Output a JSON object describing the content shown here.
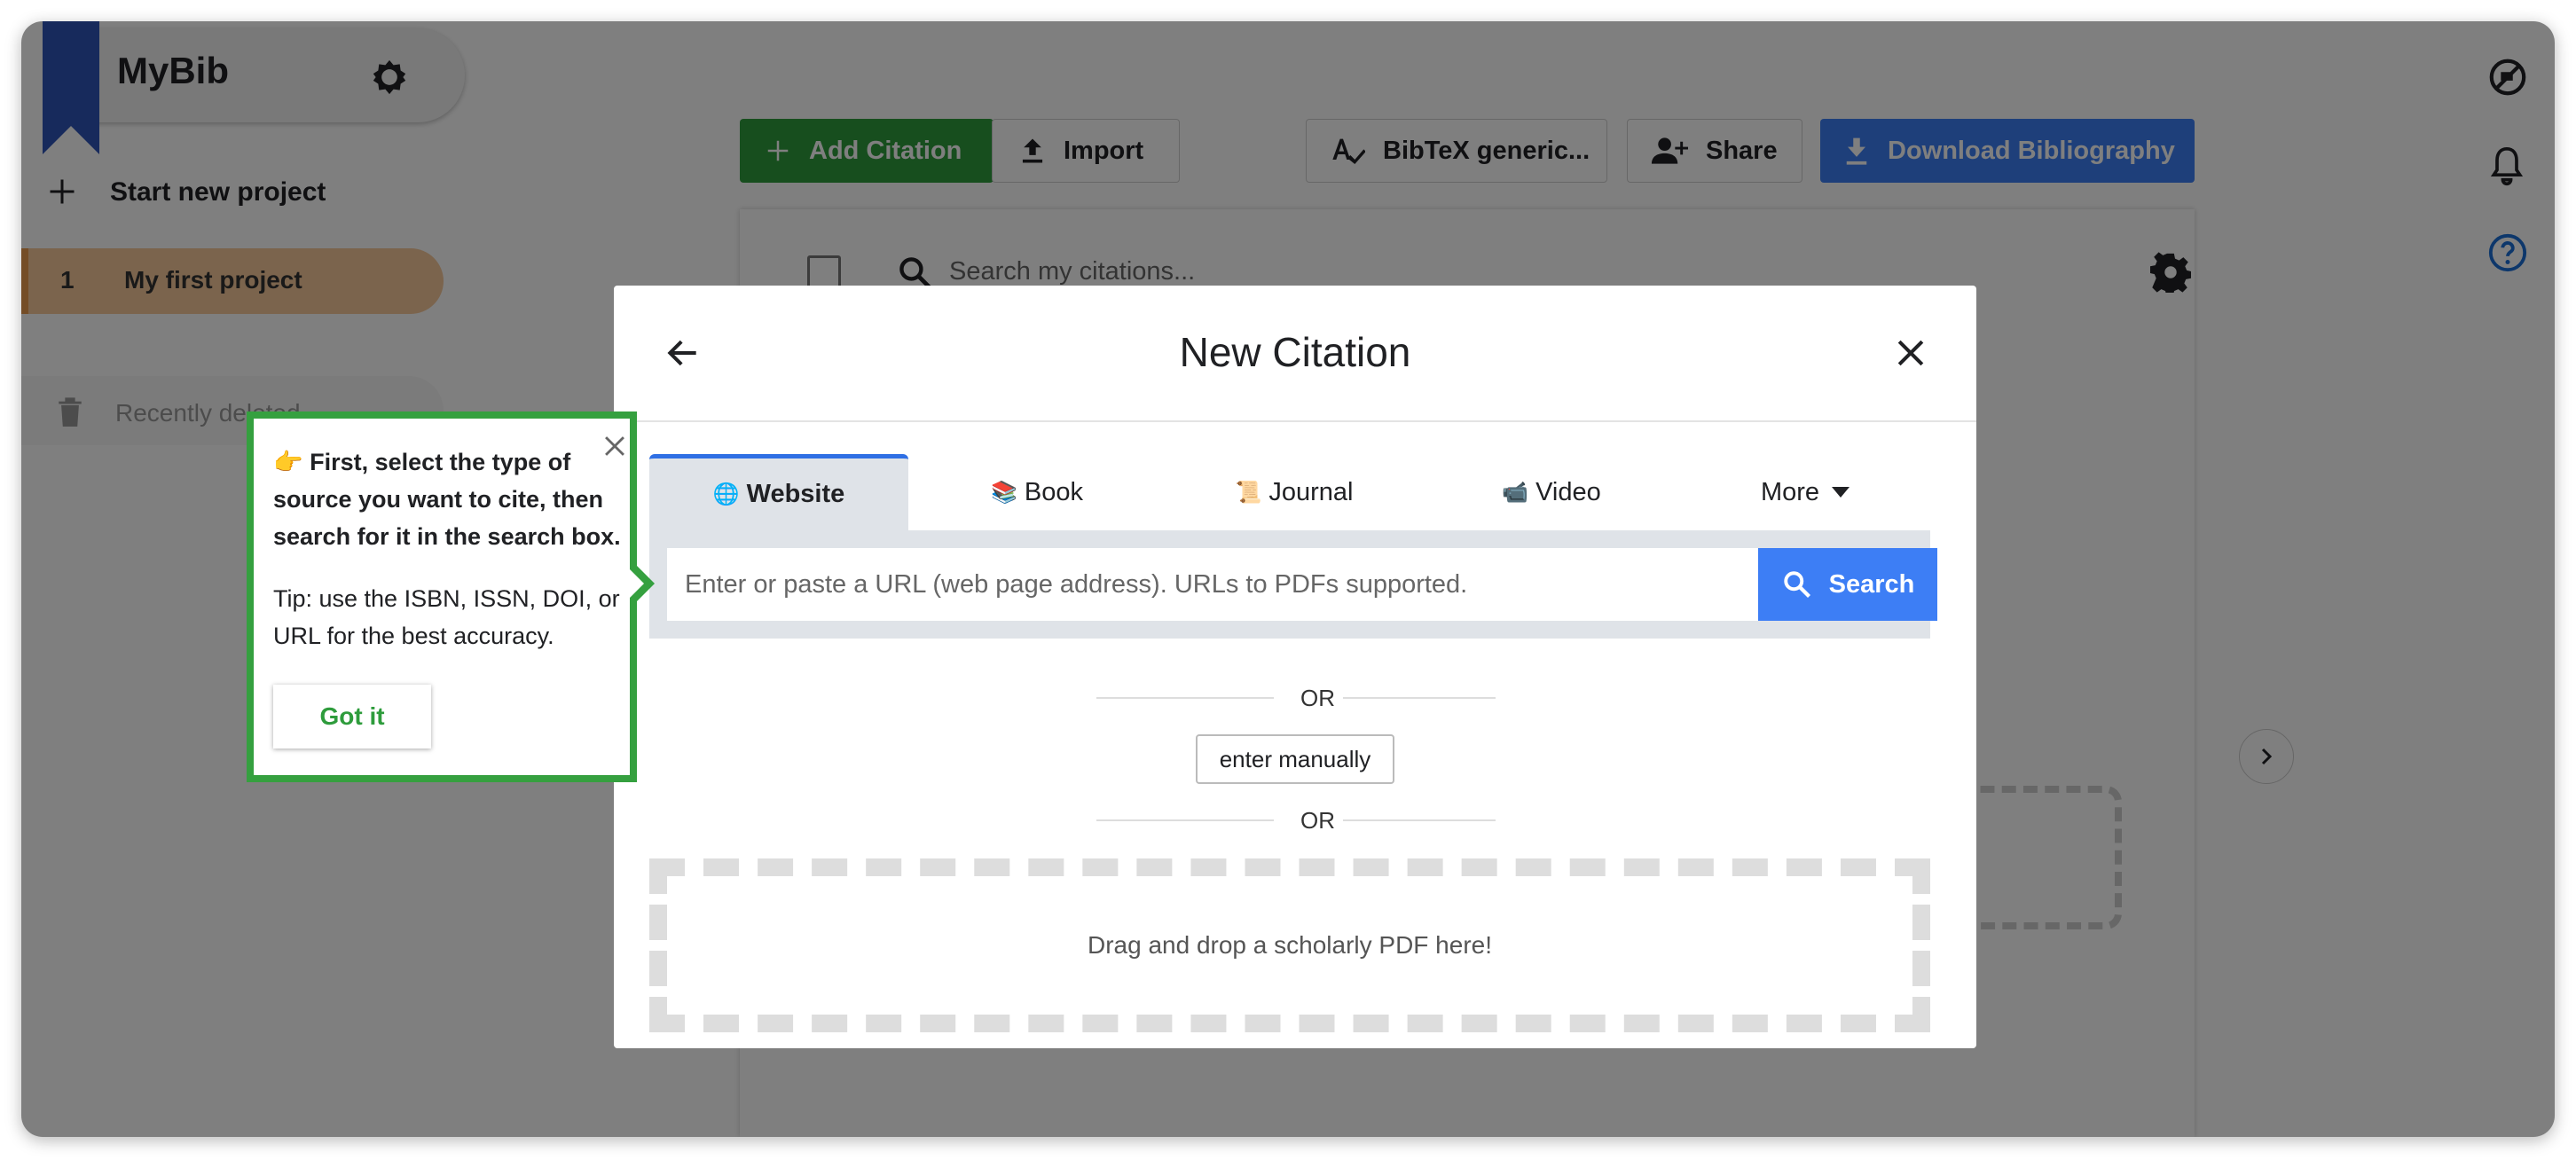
{
  "sidebar": {
    "brand": "MyBib",
    "new_project": "Start new project",
    "project_number": "1",
    "project_name": "My first project",
    "recently_deleted": "Recently deleted"
  },
  "toolbar": {
    "add_citation": "Add Citation",
    "import": "Import",
    "style": "BibTeX generic...",
    "share": "Share",
    "download": "Download Bibliography"
  },
  "list": {
    "search_placeholder": "Search my citations..."
  },
  "modal": {
    "title": "New Citation",
    "tabs": [
      {
        "emoji": "🌐",
        "label": "Website"
      },
      {
        "emoji": "📚",
        "label": "Book"
      },
      {
        "emoji": "📜",
        "label": "Journal"
      },
      {
        "emoji": "📹",
        "label": "Video"
      },
      {
        "emoji": "",
        "label": "More"
      }
    ],
    "url_placeholder": "Enter or paste a URL (web page address). URLs to PDFs supported.",
    "search_button": "Search",
    "or": "OR",
    "enter_manually": "enter manually",
    "dropzone": "Drag and drop a scholarly PDF here!"
  },
  "tooltip": {
    "main": "👉 First, select the type of source you want to cite, then search for it in the search box.",
    "tip": "Tip: use the ISBN, ISSN, DOI, or URL for the best accuracy.",
    "got_it": "Got it"
  },
  "colors": {
    "accent_green": "#2e9c3c",
    "accent_blue": "#3d7ef5",
    "project_highlight": "#f7c89a"
  },
  "icons": [
    "theme-icon",
    "plus-icon",
    "trash-icon",
    "upload-icon",
    "spellcheck-icon",
    "add-person-icon",
    "download-icon",
    "search-icon",
    "gear-icon",
    "no-ads-icon",
    "bell-icon",
    "help-icon",
    "chevron-right-icon",
    "arrow-left-icon",
    "close-icon",
    "caret-down-icon"
  ]
}
